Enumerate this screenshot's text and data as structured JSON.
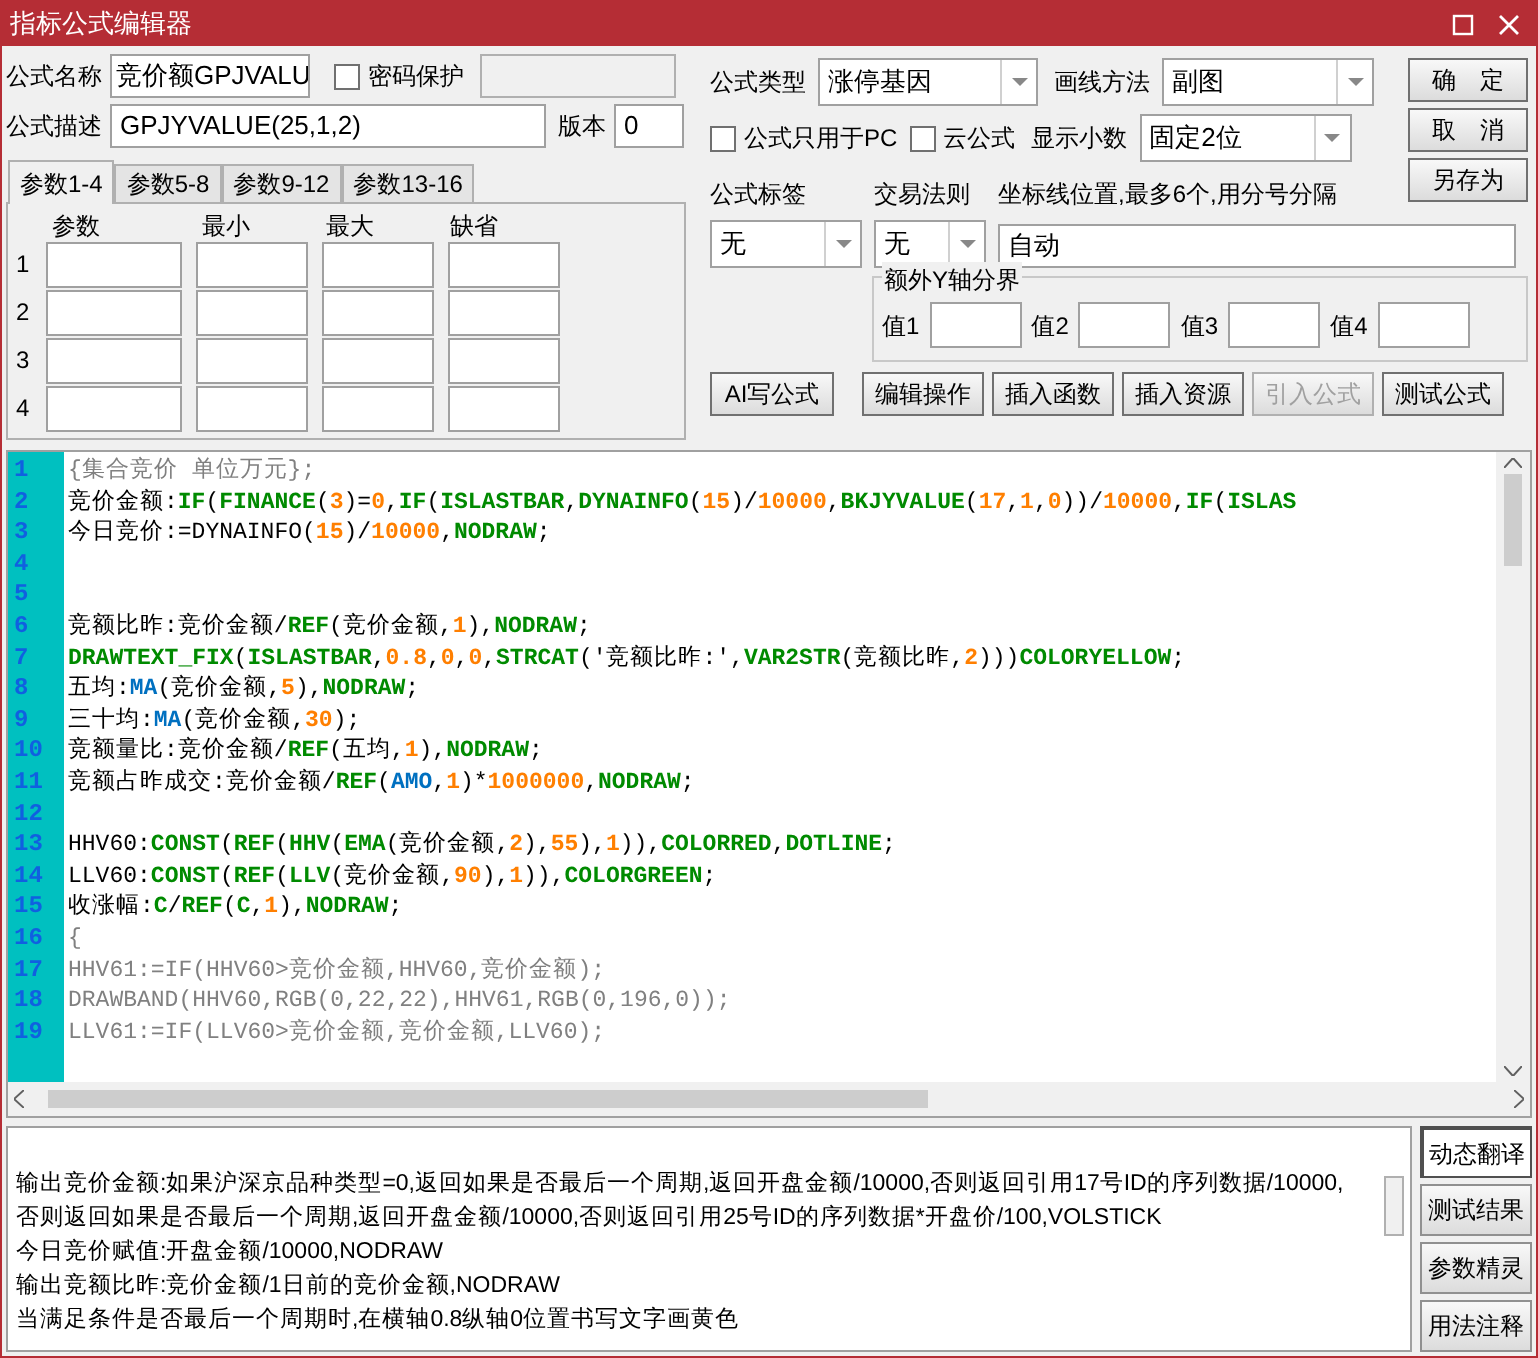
{
  "window": {
    "title": "指标公式编辑器"
  },
  "name_field": {
    "label": "公式名称",
    "value": "竞价额GPJVALU"
  },
  "password": {
    "label": "密码保护",
    "checked": false
  },
  "desc_field": {
    "label": "公式描述",
    "value": "GPJYVALUE(25,1,2)"
  },
  "version_field": {
    "label": "版本",
    "value": "0"
  },
  "param_tabs": [
    {
      "label": "参数1-4",
      "selected": true
    },
    {
      "label": "参数5-8",
      "selected": false
    },
    {
      "label": "参数9-12",
      "selected": false
    },
    {
      "label": "参数13-16",
      "selected": false
    }
  ],
  "param_table": {
    "columns": [
      "参数",
      "最小",
      "最大",
      "缺省"
    ],
    "rows": [
      "1",
      "2",
      "3",
      "4"
    ]
  },
  "formula_type": {
    "label": "公式类型",
    "value": "涨停基因"
  },
  "draw_method": {
    "label": "画线方法",
    "value": "副图"
  },
  "pc_only": {
    "label": "公式只用于PC",
    "checked": false
  },
  "cloud": {
    "label": "云公式",
    "checked": false
  },
  "decimals": {
    "label": "显示小数",
    "value": "固定2位"
  },
  "tag": {
    "label": "公式标签",
    "value": "无"
  },
  "trade_rule": {
    "label": "交易法则",
    "value": "无"
  },
  "axis_lines": {
    "label": "坐标线位置,最多6个,用分号分隔",
    "value": "自动"
  },
  "y_axis_group": {
    "title": "额外Y轴分界",
    "labels": [
      "值1",
      "值2",
      "值3",
      "值4"
    ]
  },
  "side_buttons": [
    "确　定",
    "取　消",
    "另存为"
  ],
  "action_buttons": [
    {
      "label": "AI写公式",
      "disabled": false
    },
    {
      "label": "编辑操作",
      "disabled": false
    },
    {
      "label": "插入函数",
      "disabled": false
    },
    {
      "label": "插入资源",
      "disabled": false
    },
    {
      "label": "引入公式",
      "disabled": true
    },
    {
      "label": "测试公式",
      "disabled": false
    }
  ],
  "code": [
    {
      "n": "1",
      "tokens": [
        {
          "t": "{集合竞价 单位万元};",
          "kind": "comment"
        }
      ]
    },
    {
      "n": "2",
      "tokens": [
        {
          "t": "竞价金额:",
          "kind": "plain"
        },
        {
          "t": "IF",
          "kind": "func"
        },
        {
          "t": "(",
          "kind": "plain"
        },
        {
          "t": "FINANCE",
          "kind": "func"
        },
        {
          "t": "(",
          "kind": "plain"
        },
        {
          "t": "3",
          "kind": "num"
        },
        {
          "t": ")=",
          "kind": "plain"
        },
        {
          "t": "0",
          "kind": "num"
        },
        {
          "t": ",",
          "kind": "plain"
        },
        {
          "t": "IF",
          "kind": "func"
        },
        {
          "t": "(",
          "kind": "plain"
        },
        {
          "t": "ISLASTBAR",
          "kind": "func"
        },
        {
          "t": ",",
          "kind": "plain"
        },
        {
          "t": "DYNAINFO",
          "kind": "func"
        },
        {
          "t": "(",
          "kind": "plain"
        },
        {
          "t": "15",
          "kind": "num"
        },
        {
          "t": ")/",
          "kind": "plain"
        },
        {
          "t": "10000",
          "kind": "num"
        },
        {
          "t": ",",
          "kind": "plain"
        },
        {
          "t": "BKJYVALUE",
          "kind": "func"
        },
        {
          "t": "(",
          "kind": "plain"
        },
        {
          "t": "17",
          "kind": "num"
        },
        {
          "t": ",",
          "kind": "plain"
        },
        {
          "t": "1",
          "kind": "num"
        },
        {
          "t": ",",
          "kind": "plain"
        },
        {
          "t": "0",
          "kind": "num"
        },
        {
          "t": "))/",
          "kind": "plain"
        },
        {
          "t": "10000",
          "kind": "num"
        },
        {
          "t": ",",
          "kind": "plain"
        },
        {
          "t": "IF",
          "kind": "func"
        },
        {
          "t": "(",
          "kind": "plain"
        },
        {
          "t": "ISLAS",
          "kind": "func"
        }
      ]
    },
    {
      "n": "3",
      "tokens": [
        {
          "t": "今日竞价:=DYNAINFO(",
          "kind": "plain"
        },
        {
          "t": "15",
          "kind": "num"
        },
        {
          "t": ")/",
          "kind": "plain"
        },
        {
          "t": "10000",
          "kind": "num"
        },
        {
          "t": ",",
          "kind": "plain"
        },
        {
          "t": "NODRAW",
          "kind": "func"
        },
        {
          "t": ";",
          "kind": "plain"
        }
      ]
    },
    {
      "n": "4"
    },
    {
      "n": "5"
    },
    {
      "n": "6",
      "tokens": [
        {
          "t": "竞额比昨:竞价金额/",
          "kind": "plain"
        },
        {
          "t": "REF",
          "kind": "func"
        },
        {
          "t": "(竞价金额,",
          "kind": "plain"
        },
        {
          "t": "1",
          "kind": "num"
        },
        {
          "t": "),",
          "kind": "plain"
        },
        {
          "t": "NODRAW",
          "kind": "func"
        },
        {
          "t": ";",
          "kind": "plain"
        }
      ]
    },
    {
      "n": "7",
      "tokens": [
        {
          "t": "DRAWTEXT_FIX",
          "kind": "func"
        },
        {
          "t": "(",
          "kind": "plain"
        },
        {
          "t": "ISLASTBAR",
          "kind": "func"
        },
        {
          "t": ",",
          "kind": "plain"
        },
        {
          "t": "0.8",
          "kind": "num"
        },
        {
          "t": ",",
          "kind": "plain"
        },
        {
          "t": "0",
          "kind": "num"
        },
        {
          "t": ",",
          "kind": "plain"
        },
        {
          "t": "0",
          "kind": "num"
        },
        {
          "t": ",",
          "kind": "plain"
        },
        {
          "t": "STRCAT",
          "kind": "func"
        },
        {
          "t": "('竞额比昨:',",
          "kind": "plain"
        },
        {
          "t": "VAR2STR",
          "kind": "func"
        },
        {
          "t": "(竞额比昨,",
          "kind": "plain"
        },
        {
          "t": "2",
          "kind": "num"
        },
        {
          "t": ")))",
          "kind": "plain"
        },
        {
          "t": "COLORYELLOW",
          "kind": "func"
        },
        {
          "t": ";",
          "kind": "plain"
        }
      ]
    },
    {
      "n": "8",
      "tokens": [
        {
          "t": "五均:",
          "kind": "plain"
        },
        {
          "t": "MA",
          "kind": "keyword"
        },
        {
          "t": "(竞价金额,",
          "kind": "plain"
        },
        {
          "t": "5",
          "kind": "num"
        },
        {
          "t": "),",
          "kind": "plain"
        },
        {
          "t": "NODRAW",
          "kind": "func"
        },
        {
          "t": ";",
          "kind": "plain"
        }
      ]
    },
    {
      "n": "9",
      "tokens": [
        {
          "t": "三十均:",
          "kind": "plain"
        },
        {
          "t": "MA",
          "kind": "keyword"
        },
        {
          "t": "(竞价金额,",
          "kind": "plain"
        },
        {
          "t": "30",
          "kind": "num"
        },
        {
          "t": ");",
          "kind": "plain"
        }
      ]
    },
    {
      "n": "10",
      "tokens": [
        {
          "t": "竞额量比:竞价金额/",
          "kind": "plain"
        },
        {
          "t": "REF",
          "kind": "func"
        },
        {
          "t": "(五均,",
          "kind": "plain"
        },
        {
          "t": "1",
          "kind": "num"
        },
        {
          "t": "),",
          "kind": "plain"
        },
        {
          "t": "NODRAW",
          "kind": "func"
        },
        {
          "t": ";",
          "kind": "plain"
        }
      ]
    },
    {
      "n": "11",
      "tokens": [
        {
          "t": "竞额占昨成交:竞价金额/",
          "kind": "plain"
        },
        {
          "t": "REF",
          "kind": "func"
        },
        {
          "t": "(",
          "kind": "plain"
        },
        {
          "t": "AMO",
          "kind": "keyword"
        },
        {
          "t": ",",
          "kind": "plain"
        },
        {
          "t": "1",
          "kind": "num"
        },
        {
          "t": ")*",
          "kind": "plain"
        },
        {
          "t": "1000000",
          "kind": "num"
        },
        {
          "t": ",",
          "kind": "plain"
        },
        {
          "t": "NODRAW",
          "kind": "func"
        },
        {
          "t": ";",
          "kind": "plain"
        }
      ]
    },
    {
      "n": "12"
    },
    {
      "n": "13",
      "tokens": [
        {
          "t": "HHV60:",
          "kind": "plain"
        },
        {
          "t": "CONST",
          "kind": "func"
        },
        {
          "t": "(",
          "kind": "plain"
        },
        {
          "t": "REF",
          "kind": "func"
        },
        {
          "t": "(",
          "kind": "plain"
        },
        {
          "t": "HHV",
          "kind": "func"
        },
        {
          "t": "(",
          "kind": "plain"
        },
        {
          "t": "EMA",
          "kind": "func"
        },
        {
          "t": "(竞价金额,",
          "kind": "plain"
        },
        {
          "t": "2",
          "kind": "num"
        },
        {
          "t": "),",
          "kind": "plain"
        },
        {
          "t": "55",
          "kind": "num"
        },
        {
          "t": "),",
          "kind": "plain"
        },
        {
          "t": "1",
          "kind": "num"
        },
        {
          "t": ")),",
          "kind": "plain"
        },
        {
          "t": "COLORRED",
          "kind": "func"
        },
        {
          "t": ",",
          "kind": "plain"
        },
        {
          "t": "DOTLINE",
          "kind": "func"
        },
        {
          "t": ";",
          "kind": "plain"
        }
      ]
    },
    {
      "n": "14",
      "tokens": [
        {
          "t": "LLV60:",
          "kind": "plain"
        },
        {
          "t": "CONST",
          "kind": "func"
        },
        {
          "t": "(",
          "kind": "plain"
        },
        {
          "t": "REF",
          "kind": "func"
        },
        {
          "t": "(",
          "kind": "plain"
        },
        {
          "t": "LLV",
          "kind": "func"
        },
        {
          "t": "(竞价金额,",
          "kind": "plain"
        },
        {
          "t": "90",
          "kind": "num"
        },
        {
          "t": "),",
          "kind": "plain"
        },
        {
          "t": "1",
          "kind": "num"
        },
        {
          "t": ")),",
          "kind": "plain"
        },
        {
          "t": "COLORGREEN",
          "kind": "func"
        },
        {
          "t": ";",
          "kind": "plain"
        }
      ]
    },
    {
      "n": "15",
      "tokens": [
        {
          "t": "收涨幅:",
          "kind": "plain"
        },
        {
          "t": "C",
          "kind": "func"
        },
        {
          "t": "/",
          "kind": "plain"
        },
        {
          "t": "REF",
          "kind": "func"
        },
        {
          "t": "(",
          "kind": "plain"
        },
        {
          "t": "C",
          "kind": "func"
        },
        {
          "t": ",",
          "kind": "plain"
        },
        {
          "t": "1",
          "kind": "num"
        },
        {
          "t": "),",
          "kind": "plain"
        },
        {
          "t": "NODRAW",
          "kind": "func"
        },
        {
          "t": ";",
          "kind": "plain"
        }
      ]
    },
    {
      "n": "16",
      "tokens": [
        {
          "t": "{",
          "kind": "comment"
        }
      ]
    },
    {
      "n": "17",
      "tokens": [
        {
          "t": "HHV61:=IF(HHV60>竞价金额,HHV60,竞价金额);",
          "kind": "comment"
        }
      ]
    },
    {
      "n": "18",
      "tokens": [
        {
          "t": "DRAWBAND(HHV60,RGB(0,22,22),HHV61,RGB(0,196,0));",
          "kind": "comment"
        }
      ]
    },
    {
      "n": "19",
      "tokens": [
        {
          "t": "LLV61:=IF(LLV60>竞价金额,竞价金额,LLV60);",
          "kind": "comment"
        }
      ]
    }
  ],
  "output_lines": [
    "输出竞价金额:如果沪深京品种类型=0,返回如果是否最后一个周期,返回开盘金额/10000,否则返回引用17号ID的序列数据/10000,",
    "否则返回如果是否最后一个周期,返回开盘金额/10000,否则返回引用25号ID的序列数据*开盘价/100,VOLSTICK",
    "今日竞价赋值:开盘金额/10000,NODRAW",
    "输出竞额比昨:竞价金额/1日前的竞价金额,NODRAW",
    "当满足条件是否最后一个周期时,在横轴0.8纵轴0位置书写文字画黄色"
  ],
  "output_tabs": [
    {
      "label": "动态翻译",
      "selected": true
    },
    {
      "label": "测试结果",
      "selected": false
    },
    {
      "label": "参数精灵",
      "selected": false
    },
    {
      "label": "用法注释",
      "selected": false
    }
  ]
}
